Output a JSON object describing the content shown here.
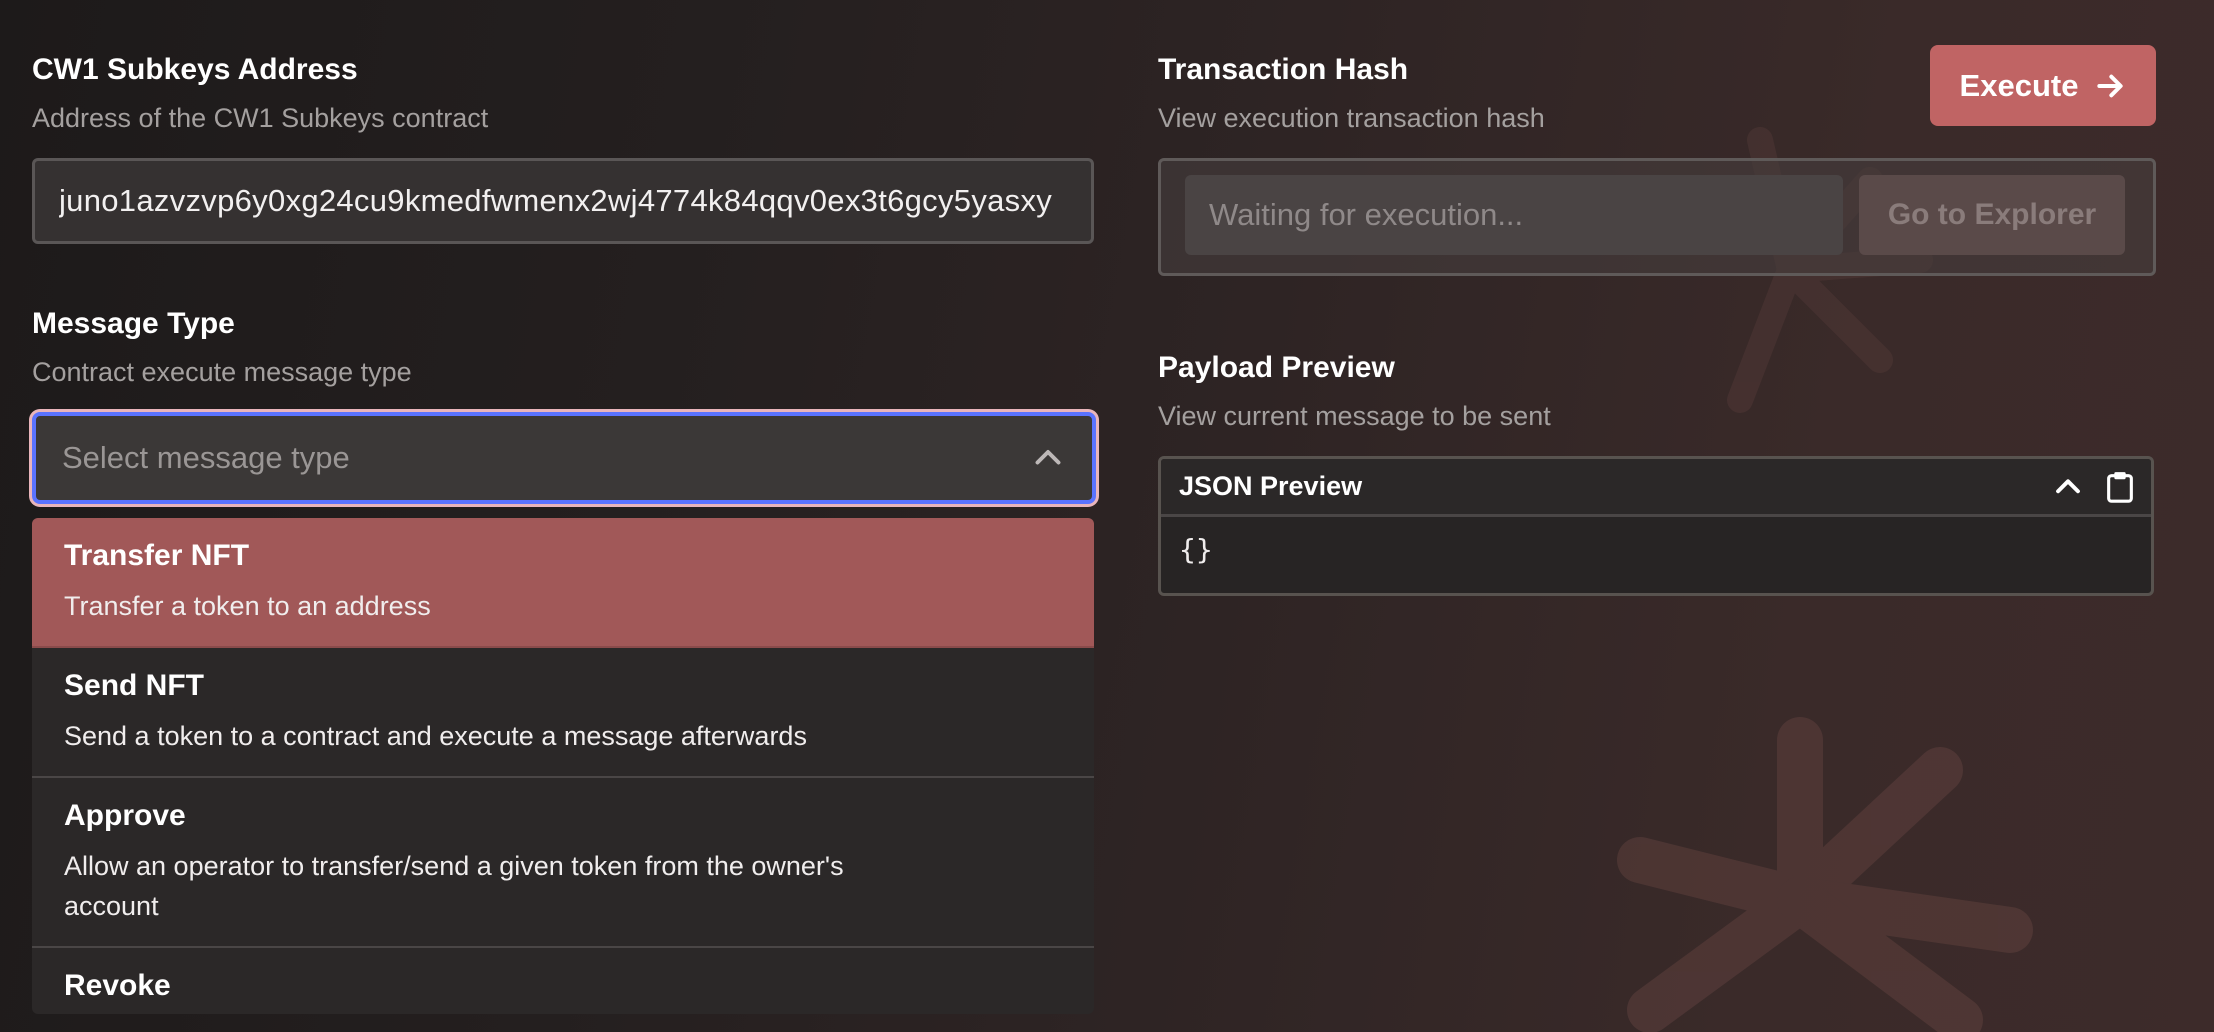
{
  "address": {
    "label": "CW1 Subkeys Address",
    "description": "Address of the CW1 Subkeys contract",
    "value": "juno1azvzvp6y0xg24cu9kmedfwmenx2wj4774k84qqv0ex3t6gcy5yasxy"
  },
  "message_type": {
    "label": "Message Type",
    "description": "Contract execute message type",
    "placeholder": "Select message type",
    "options": [
      {
        "title": "Transfer NFT",
        "description": "Transfer a token to an address"
      },
      {
        "title": "Send NFT",
        "description": "Send a token to a contract and execute a message afterwards"
      },
      {
        "title": "Approve",
        "description": "Allow an operator to transfer/send a given token from the owner's account"
      },
      {
        "title": "Revoke",
        "description": ""
      }
    ]
  },
  "transaction": {
    "label": "Transaction Hash",
    "description": "View execution transaction hash",
    "placeholder": "Waiting for execution...",
    "explorer_label": "Go to Explorer"
  },
  "execute": {
    "label": "Execute"
  },
  "payload": {
    "label": "Payload Preview",
    "description": "View current message to be sent",
    "preview_title": "JSON Preview",
    "content": "{}"
  },
  "colors": {
    "accent": "#c06464",
    "selected_option": "#a15858",
    "focus_ring": "#5a73ff"
  }
}
